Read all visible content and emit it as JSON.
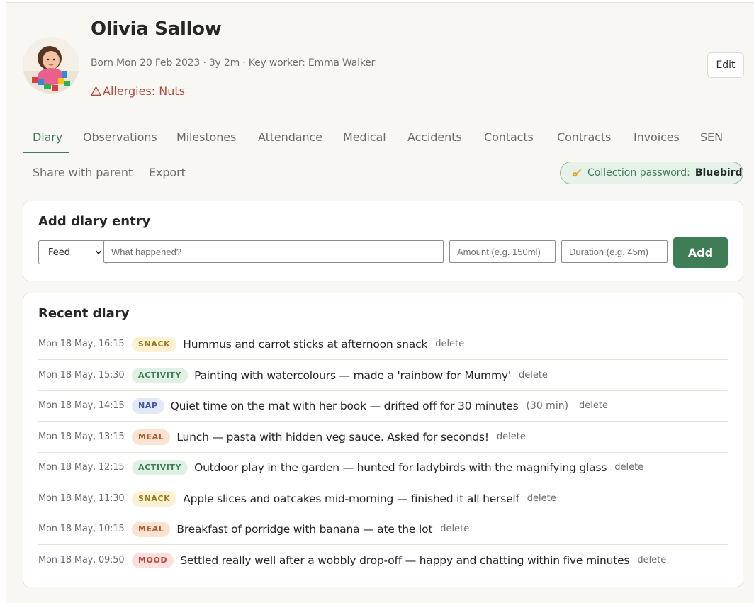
{
  "profile": {
    "name": "Olivia Sallow",
    "meta": "Born Mon 20 Feb 2023 · 3y 2m · Key worker: Emma Walker",
    "allergies": "Allergies: Nuts",
    "edit_label": "Edit"
  },
  "tabs": [
    {
      "label": "Diary",
      "active": true
    },
    {
      "label": "Observations",
      "active": false
    },
    {
      "label": "Milestones",
      "active": false
    },
    {
      "label": "Attendance",
      "active": false
    },
    {
      "label": "Medical",
      "active": false
    },
    {
      "label": "Accidents",
      "active": false
    },
    {
      "label": "Contacts",
      "active": false
    },
    {
      "label": "Contracts",
      "active": false
    },
    {
      "label": "Invoices",
      "active": false
    },
    {
      "label": "SEN",
      "active": false
    },
    {
      "label": "Share with parent",
      "active": false
    },
    {
      "label": "Export",
      "active": false
    }
  ],
  "password": {
    "label": "Collection password:",
    "value": "Bluebird",
    "icon": "key-icon"
  },
  "add_entry": {
    "title": "Add diary entry",
    "type_value": "Feed",
    "what_placeholder": "What happened?",
    "amount_placeholder": "Amount (e.g. 150ml)",
    "duration_placeholder": "Duration (e.g. 45m)",
    "add_label": "Add"
  },
  "recent": {
    "title": "Recent diary",
    "delete_label": "delete",
    "entries": [
      {
        "time": "Mon 18 May, 16:15",
        "badge": "SNACK",
        "text": "Hummus and carrot sticks at afternoon snack",
        "extra": ""
      },
      {
        "time": "Mon 18 May, 15:30",
        "badge": "ACTIVITY",
        "text": "Painting with watercolours — made a 'rainbow for Mummy'",
        "extra": ""
      },
      {
        "time": "Mon 18 May, 14:15",
        "badge": "NAP",
        "text": "Quiet time on the mat with her book — drifted off for 30 minutes",
        "extra": "(30 min)"
      },
      {
        "time": "Mon 18 May, 13:15",
        "badge": "MEAL",
        "text": "Lunch — pasta with hidden veg sauce. Asked for seconds!",
        "extra": ""
      },
      {
        "time": "Mon 18 May, 12:15",
        "badge": "ACTIVITY",
        "text": "Outdoor play in the garden — hunted for ladybirds with the magnifying glass",
        "extra": ""
      },
      {
        "time": "Mon 18 May, 11:30",
        "badge": "SNACK",
        "text": "Apple slices and oatcakes mid-morning — finished it all herself",
        "extra": ""
      },
      {
        "time": "Mon 18 May, 10:15",
        "badge": "MEAL",
        "text": "Breakfast of porridge with banana — ate the lot",
        "extra": ""
      },
      {
        "time": "Mon 18 May, 09:50",
        "badge": "MOOD",
        "text": "Settled really well after a wobbly drop-off — happy and chatting within five minutes",
        "extra": ""
      }
    ]
  },
  "colors": {
    "accent": "#3f7d57",
    "allergy": "#b5463a",
    "badge_snack_bg": "#fbf2d4",
    "badge_snack_fg": "#9a7a1c",
    "badge_activity_bg": "#e1f0e4",
    "badge_activity_fg": "#3f7d57",
    "badge_nap_bg": "#e2e8f8",
    "badge_nap_fg": "#3f5ba8",
    "badge_meal_bg": "#fbe3d3",
    "badge_meal_fg": "#b05a2a",
    "badge_mood_bg": "#fbe0de",
    "badge_mood_fg": "#b9483f"
  }
}
